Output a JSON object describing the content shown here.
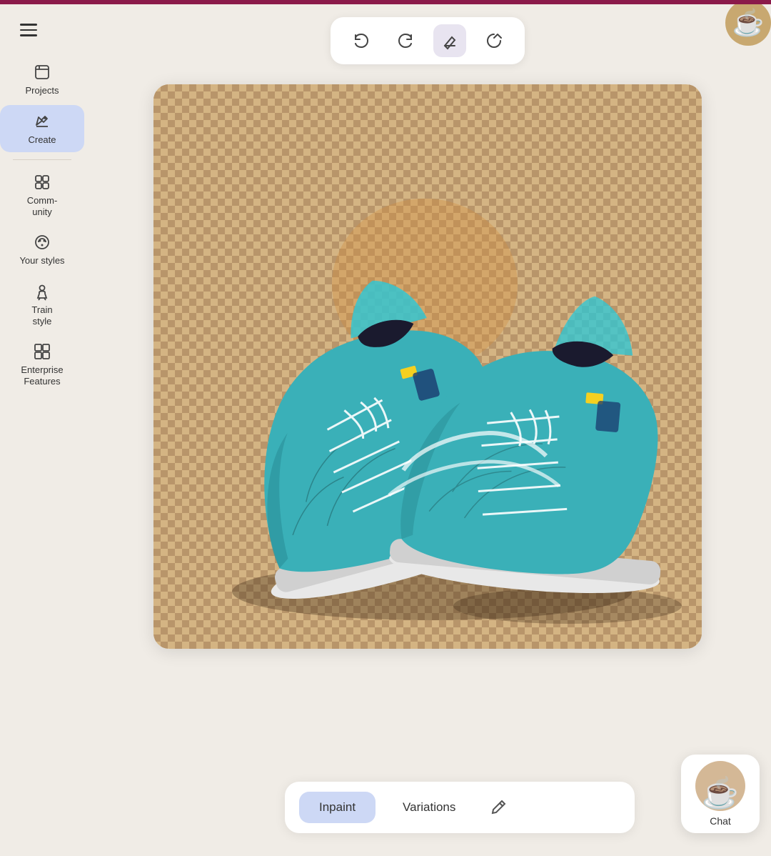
{
  "topBar": {},
  "sidebar": {
    "items": [
      {
        "id": "projects",
        "label": "Projects",
        "icon": "🗂"
      },
      {
        "id": "create",
        "label": "Create",
        "icon": "✏️",
        "active": true
      },
      {
        "id": "community",
        "label": "Comm-\nunity",
        "icon": "⊞"
      },
      {
        "id": "your-styles",
        "label": "Your styles",
        "icon": "🎨"
      },
      {
        "id": "train-style",
        "label": "Train style",
        "icon": "🤸"
      },
      {
        "id": "enterprise",
        "label": "Enterprise Features",
        "icon": "📋"
      }
    ]
  },
  "toolbar": {
    "undo_label": "↩",
    "redo_label": "↪",
    "eraser_label": "◇",
    "reset_label": "↺"
  },
  "bottomPanel": {
    "tabs": [
      {
        "id": "inpaint",
        "label": "Inpaint",
        "active": true
      },
      {
        "id": "variations",
        "label": "Variations",
        "active": false
      }
    ],
    "edit_icon": "✏"
  },
  "chat": {
    "label": "Chat"
  },
  "colors": {
    "topBarAccent": "#8b1a4a",
    "activeNavBg": "#cdd8f5",
    "activeTabBg": "#cdd8f5",
    "mainBg": "#f0ece6"
  }
}
